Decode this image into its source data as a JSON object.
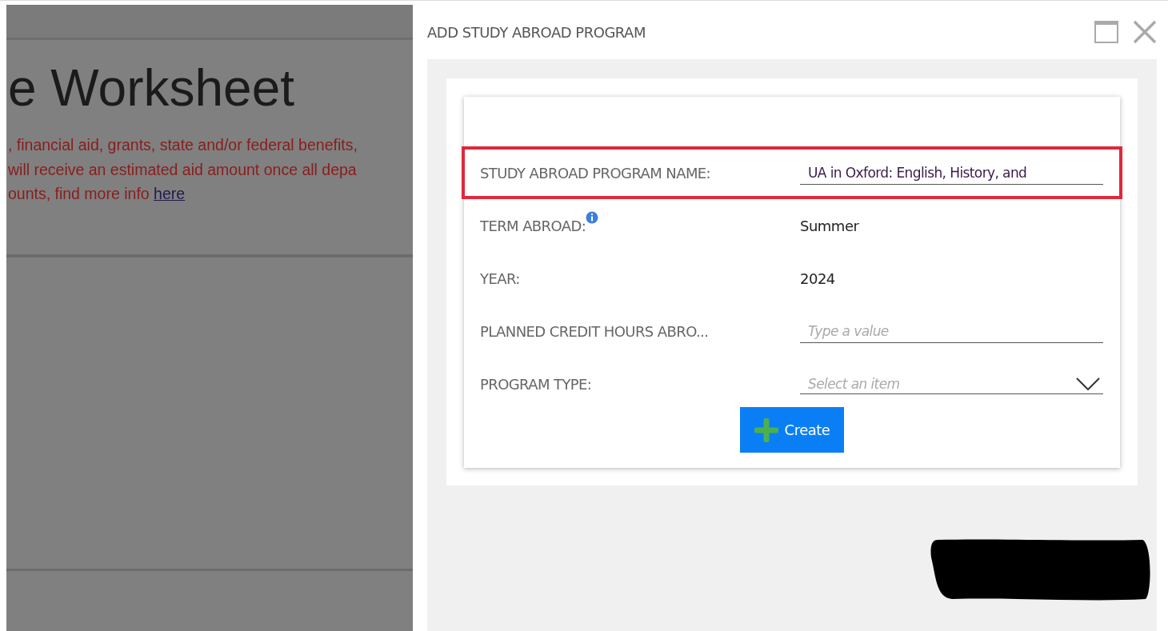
{
  "background_page": {
    "title": "e Worksheet",
    "notice_lines": [
      ", financial aid, grants, state and/or federal benefits,",
      " will receive an estimated aid amount once all depa",
      "ounts, find more info "
    ],
    "notice_link": "here "
  },
  "dialog": {
    "title": "ADD STUDY ABROAD PROGRAM",
    "fields": [
      {
        "kind": "text",
        "label": "STUDY ABROAD PROGRAM NAME:",
        "value": "UA in Oxford: English, History, and",
        "highlighted": true,
        "info": false
      },
      {
        "kind": "readonly",
        "label": "TERM ABROAD:",
        "value": "Summer",
        "highlighted": false,
        "info": true
      },
      {
        "kind": "readonly",
        "label": "YEAR:",
        "value": "2024",
        "highlighted": false,
        "info": false
      },
      {
        "kind": "text",
        "label": "PLANNED CREDIT HOURS ABRO...",
        "placeholder": "Type a value",
        "highlighted": false,
        "info": false
      },
      {
        "kind": "select",
        "label": "PROGRAM TYPE:",
        "placeholder": "Select an item",
        "highlighted": false,
        "info": false
      }
    ],
    "create_button": "Create"
  }
}
